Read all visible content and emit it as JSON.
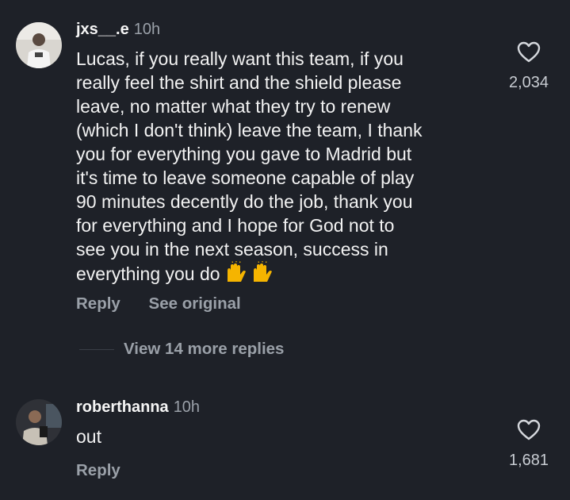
{
  "comments": [
    {
      "username": "jxs__.e",
      "time": "10h",
      "text": "Lucas, if you really want this team, if you\nreally feel the shirt and the shield please\nleave, no matter what they try to renew\n(which I don't think) leave the team, I thank\nyou for everything you gave to Madrid but\nit's time to leave someone capable of play\n90 minutes decently do the job, thank you\nfor everything and I hope for God not to\nsee you in the next season, success in\neverything you do",
      "emoji": "🙌🙌",
      "likes": "2,034",
      "reply_label": "Reply",
      "see_original_label": "See original"
    },
    {
      "username": "roberthanna",
      "time": "10h",
      "text": "out",
      "likes": "1,681",
      "reply_label": "Reply"
    }
  ],
  "view_replies_label": "View 14 more replies",
  "colors": {
    "background": "#1e2128",
    "muted": "#9aa0a8",
    "text": "#f2f2f2"
  },
  "icons": [
    "heart-icon",
    "raised-hands-emoji"
  ]
}
